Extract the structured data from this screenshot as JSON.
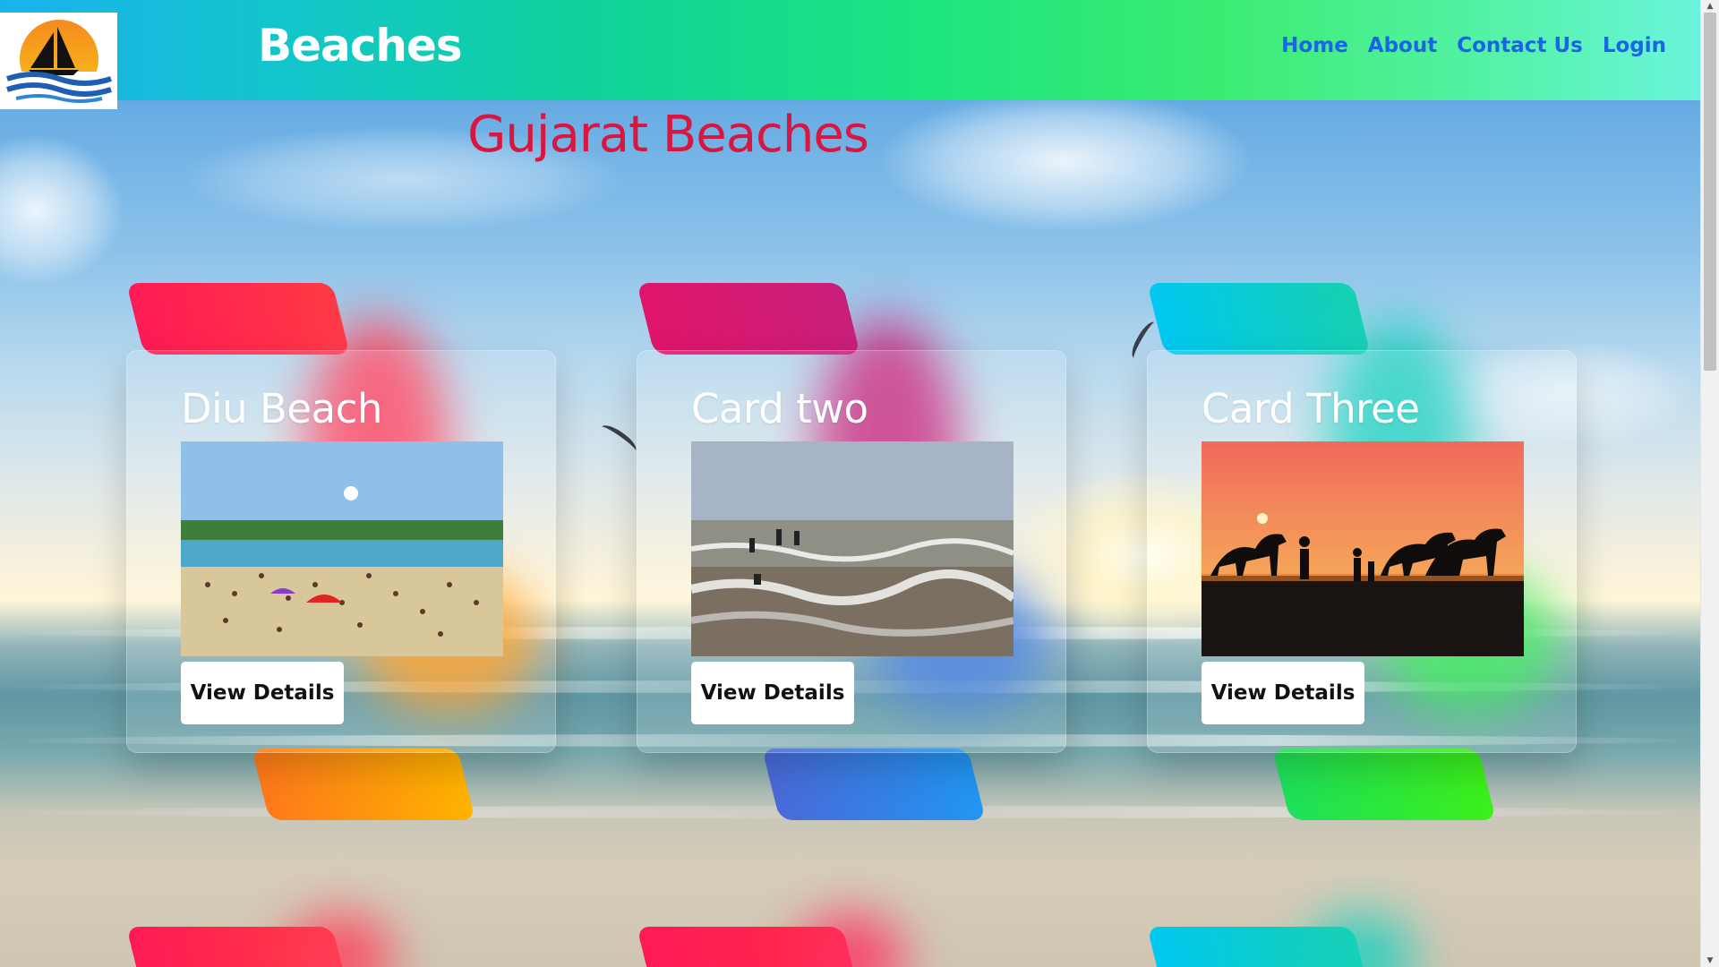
{
  "header": {
    "brand": "Beaches",
    "logo_icon": "sailboat-sunset-logo",
    "nav": [
      {
        "label": "Home"
      },
      {
        "label": "About"
      },
      {
        "label": "Contact Us"
      },
      {
        "label": "Login"
      }
    ]
  },
  "page": {
    "title": "Gujarat Beaches"
  },
  "cards": [
    {
      "title": "Diu Beach",
      "image": "crowded-beach-photo",
      "button": "View Details",
      "accent_start": "#ff1a55",
      "accent_end": "#ffb300"
    },
    {
      "title": "Card two",
      "image": "waves-beach-photo",
      "button": "View Details",
      "accent_start": "#e0156a",
      "accent_end": "#2196f3"
    },
    {
      "title": "Card Three",
      "image": "camels-sunset-photo",
      "button": "View Details",
      "accent_start": "#00c8f0",
      "accent_end": "#3cf01a"
    }
  ],
  "colors": {
    "title": "#d9163f",
    "nav_link": "#1a64e6",
    "brand": "#ffffff"
  }
}
